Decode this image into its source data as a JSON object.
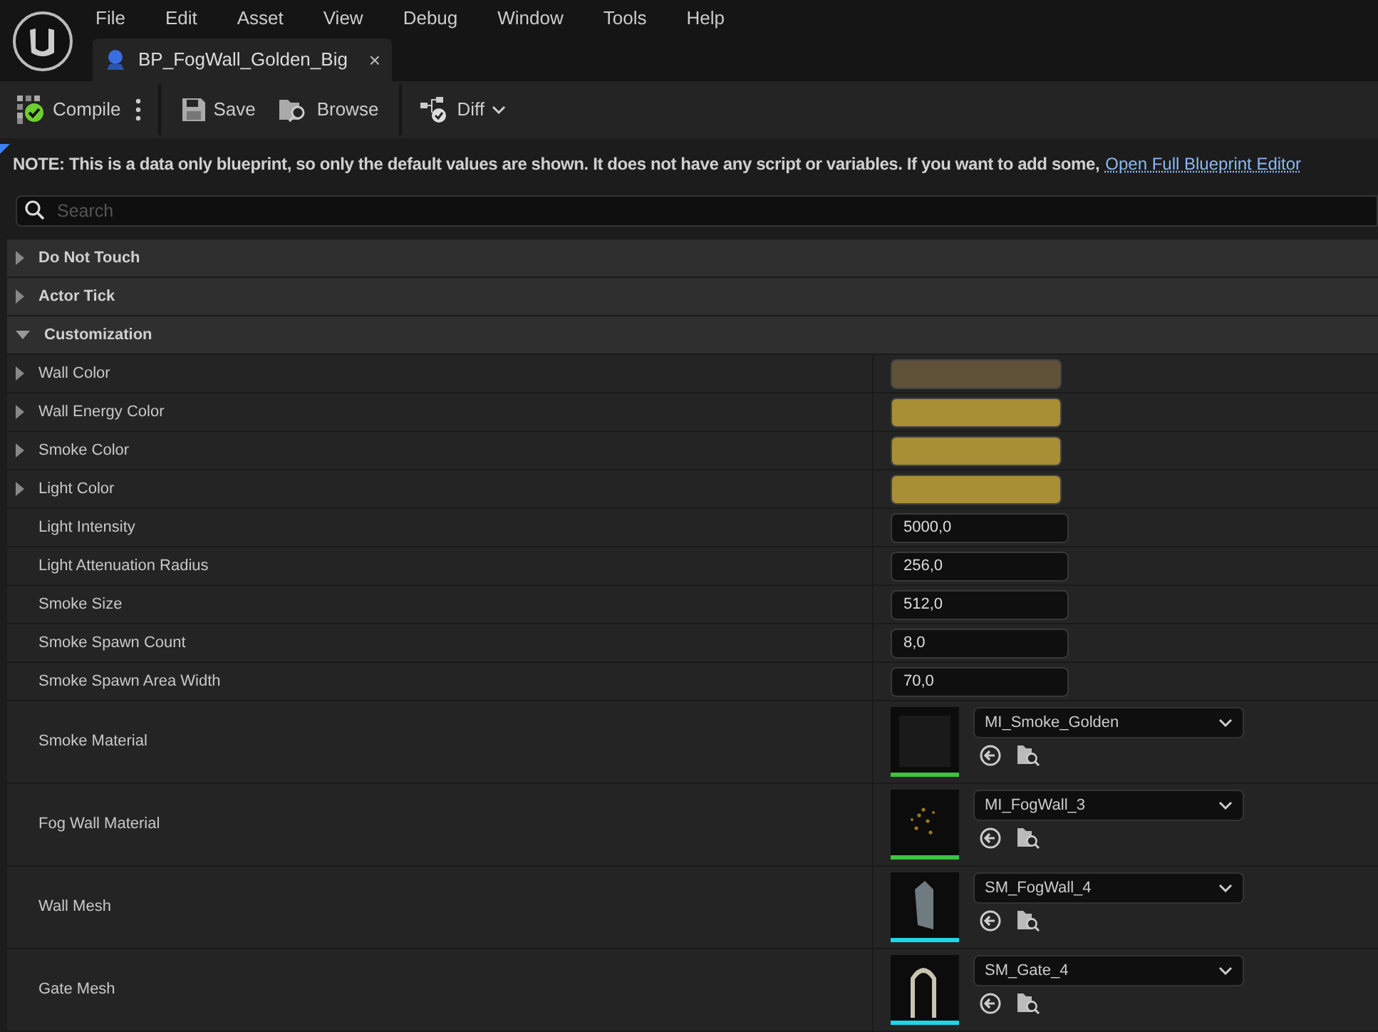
{
  "menu": [
    "File",
    "Edit",
    "Asset",
    "View",
    "Debug",
    "Window",
    "Tools",
    "Help"
  ],
  "document_tab": {
    "label": "BP_FogWall_Golden_Big",
    "close": "×"
  },
  "toolbar": [
    {
      "kind": "compile",
      "label": "Compile"
    },
    {
      "kind": "save",
      "label": "Save"
    },
    {
      "kind": "browse",
      "label": "Browse"
    },
    {
      "kind": "diff",
      "label": "Diff"
    }
  ],
  "note": {
    "text": "**NOTE: This is a data only blueprint, so only the default values are shown.  It does not have any script or variables.  If you want to add some,**",
    "link": "Open Full Blueprint Editor"
  },
  "search": {
    "placeholder": "Search"
  },
  "categories": [
    {
      "label": "Do Not Touch",
      "expanded": false
    },
    {
      "label": "Actor Tick",
      "expanded": false
    },
    {
      "label": "Customization",
      "expanded": true,
      "properties": [
        {
          "kind": "color",
          "label": "Wall Color",
          "color": "#5f5239"
        },
        {
          "kind": "color",
          "label": "Wall Energy Color",
          "color": "#a88e35"
        },
        {
          "kind": "color",
          "label": "Smoke Color",
          "color": "#a88e35"
        },
        {
          "kind": "color",
          "label": "Light Color",
          "color": "#a88e35"
        },
        {
          "kind": "number",
          "label": "Light Intensity",
          "value": "5000,0"
        },
        {
          "kind": "number",
          "label": "Light Attenuation Radius",
          "value": "256,0"
        },
        {
          "kind": "number",
          "label": "Smoke Size",
          "value": "512,0"
        },
        {
          "kind": "number",
          "label": "Smoke Spawn Count",
          "value": "8,0"
        },
        {
          "kind": "number",
          "label": "Smoke Spawn Area Width",
          "value": "70,0"
        },
        {
          "kind": "asset",
          "label": "Smoke Material",
          "value": "MI_Smoke_Golden",
          "color": "#3fc33f"
        },
        {
          "kind": "asset",
          "label": "Fog Wall Material",
          "value": "MI_FogWall_3",
          "color": "#3fc33f"
        },
        {
          "kind": "asset",
          "label": "Wall Mesh",
          "value": "SM_FogWall_4",
          "color": "#1fd6e6"
        },
        {
          "kind": "asset",
          "label": "Gate Mesh",
          "value": "SM_Gate_4",
          "color": "#1fd6e6"
        }
      ]
    }
  ]
}
